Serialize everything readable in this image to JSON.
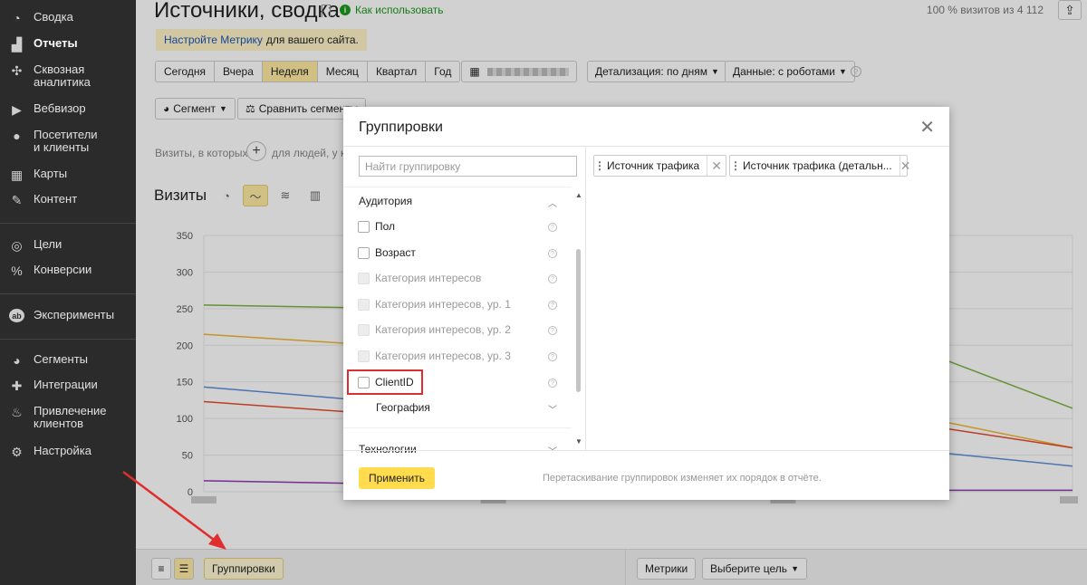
{
  "sidebar": {
    "items": [
      {
        "label": "Сводка",
        "icon": "dashboard-icon"
      },
      {
        "label": "Отчеты",
        "icon": "reports-icon"
      },
      {
        "label": "Сквозная\nаналитика",
        "icon": "end-to-end-analytics-icon"
      },
      {
        "label": "Вебвизор",
        "icon": "play-icon"
      },
      {
        "label": "Посетители\nи клиенты",
        "icon": "visitors-icon"
      },
      {
        "label": "Карты",
        "icon": "maps-icon"
      },
      {
        "label": "Контент",
        "icon": "pencil-icon"
      },
      {
        "label": "Цели",
        "icon": "target-icon"
      },
      {
        "label": "Конверсии",
        "icon": "percent-icon"
      },
      {
        "label": "Эксперименты",
        "icon": "ab-icon"
      },
      {
        "label": "Сегменты",
        "icon": "pie-icon"
      },
      {
        "label": "Интеграции",
        "icon": "puzzle-icon"
      },
      {
        "label": "Привлечение\nклиентов",
        "icon": "flame-icon"
      },
      {
        "label": "Настройка",
        "icon": "gear-icon"
      }
    ]
  },
  "header": {
    "title": "Источники, сводка",
    "howto": "Как использовать",
    "visits_pct": "100 % визитов из 4 112"
  },
  "notice": {
    "link": "Настройте Метрику",
    "text": "для вашего сайта."
  },
  "periods": [
    "Сегодня",
    "Вчера",
    "Неделя",
    "Месяц",
    "Квартал",
    "Год"
  ],
  "active_period": "Неделя",
  "toolbar": {
    "detail": "Детализация: по дням",
    "data": "Данные: с роботами",
    "segment": "Сегмент",
    "compare": "Сравнить сегменты"
  },
  "segment_hint": {
    "left": "Визиты, в которых",
    "right": "для людей, у кот"
  },
  "chart_section": {
    "title": "Визиты"
  },
  "chart_data": {
    "type": "line",
    "ylim": [
      0,
      350
    ],
    "yticks": [
      "0",
      "50",
      "100",
      "150",
      "200",
      "250",
      "300",
      "350"
    ],
    "series": [
      {
        "color": "#7cb342",
        "values": [
          255,
          248,
          264,
          114
        ]
      },
      {
        "color": "#f2b531",
        "values": [
          215,
          190,
          140,
          60
        ]
      },
      {
        "color": "#5b8fd8",
        "values": [
          143,
          110,
          75,
          35
        ]
      },
      {
        "color": "#e64a2e",
        "values": [
          123,
          95,
          120,
          60
        ]
      },
      {
        "color": "#8e3ab5",
        "values": [
          15,
          8,
          2,
          2
        ]
      }
    ]
  },
  "bottom": {
    "groupings": "Группировки",
    "metrics": "Метрики",
    "goal": "Выберите цель"
  },
  "modal": {
    "title": "Группировки",
    "search_placeholder": "Найти группировку",
    "group_audience": "Аудитория",
    "items": [
      {
        "label": "Пол",
        "disabled": false
      },
      {
        "label": "Возраст",
        "disabled": false
      },
      {
        "label": "Категория интересов",
        "disabled": true
      },
      {
        "label": "Категория интересов, ур. 1",
        "disabled": true
      },
      {
        "label": "Категория интересов, ур. 2",
        "disabled": true
      },
      {
        "label": "Категория интересов, ур. 3",
        "disabled": true
      },
      {
        "label": "ClientID",
        "disabled": false
      }
    ],
    "subgroup_geo": "География",
    "group_tech": "Технологии",
    "selected": [
      {
        "label": "Источник трафика"
      },
      {
        "label": "Источник трафика (детальн..."
      }
    ],
    "apply": "Применить",
    "footer_hint": "Перетаскивание группировок изменяет их порядок в отчёте."
  }
}
